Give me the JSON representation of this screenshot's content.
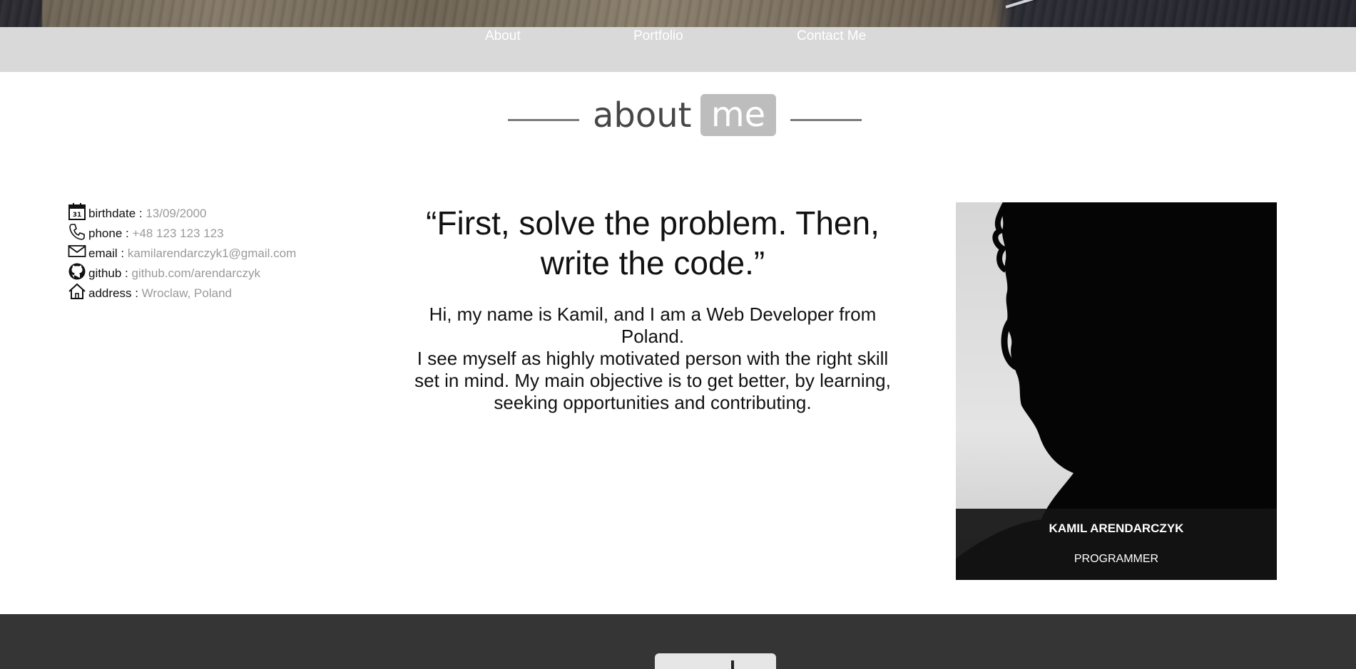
{
  "nav": {
    "about_label": "About",
    "portfolio_label": "Portfolio",
    "contact_label": "Contact Me"
  },
  "section": {
    "title_word": "about",
    "title_badge": "me"
  },
  "info": {
    "items": [
      {
        "icon": "calendar-icon",
        "label": "birthdate :",
        "value": "13/09/2000"
      },
      {
        "icon": "phone-icon",
        "label": "phone :",
        "value": "+48 123 123 123"
      },
      {
        "icon": "envelope-icon",
        "label": "email :",
        "value": "kamilarendarczyk1@gmail.com"
      },
      {
        "icon": "github-icon",
        "label": "github :",
        "value": "github.com/arendarczyk"
      },
      {
        "icon": "home-icon",
        "label": "address :",
        "value": "Wroclaw, Poland"
      }
    ],
    "calendar_day": "31"
  },
  "quote": "“First, solve the problem. Then, write the code.”",
  "bio": {
    "line1": "Hi, my name is Kamil, and I am a Web Developer from Poland.",
    "line2": "I see myself as highly motivated person with the right skill set in mind. My main objective is to get better, by learning, seeking opportunities and contributing."
  },
  "card": {
    "name": "KAMIL ARENDARCZYK",
    "role": "PROGRAMMER"
  },
  "colors": {
    "nav_bg": "#d9d9d9",
    "badge_bg": "#bdbdbd",
    "value_text": "#9a9a9a",
    "footer_bg": "#353535"
  }
}
